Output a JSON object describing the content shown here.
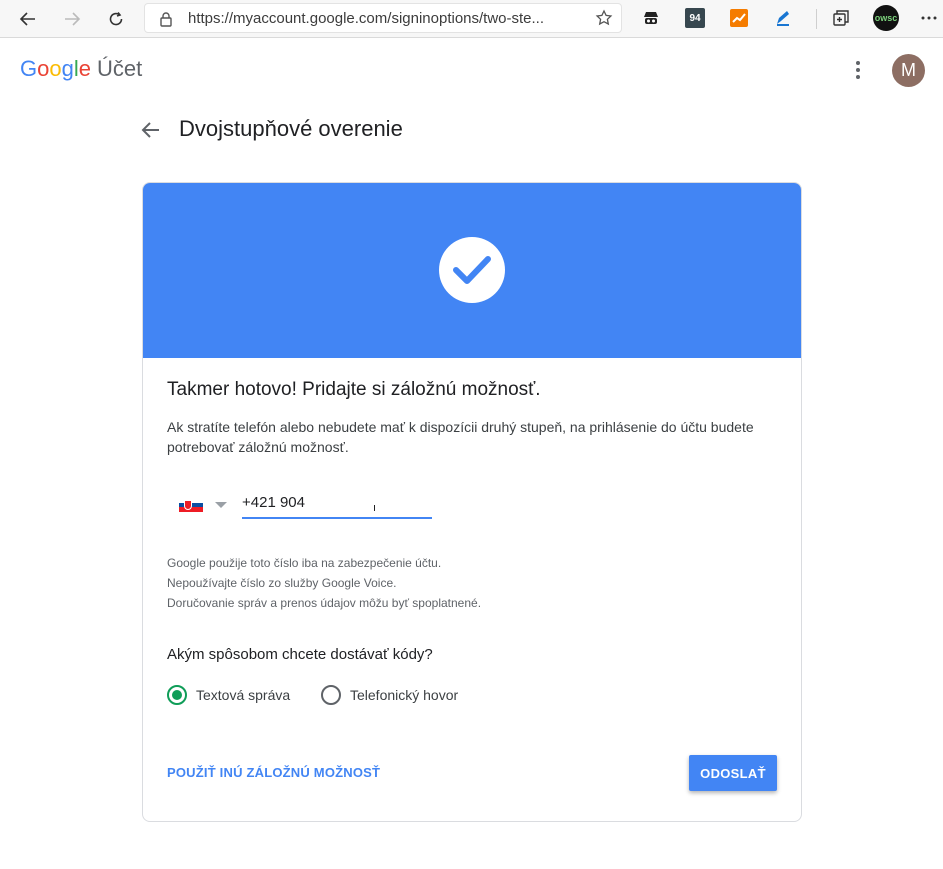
{
  "browser": {
    "url": "https://myaccount.google.com/signinoptions/two-ste...",
    "extensions": [
      "privacy-extension-icon",
      "badge-94-icon",
      "analytics-extension-icon",
      "pen-extension-icon",
      "collections-icon",
      "profile-extension-icon",
      "more-icon"
    ],
    "ext_badge": "94",
    "ext_profile": "owsc"
  },
  "header": {
    "logo_google": "Google",
    "logo_account": "Účet",
    "avatar_initial": "M"
  },
  "page": {
    "title": "Dvojstupňové overenie"
  },
  "card": {
    "hero_color": "#4285f4",
    "heading": "Takmer hotovo! Pridajte si záložnú možnosť.",
    "description": "Ak stratíte telefón alebo nebudete mať k dispozícii druhý stupeň, na prihlásenie do účtu budete potrebovať záložnú možnosť.",
    "country_flag": "Slovakia",
    "phone_value": "+421 904",
    "notes": [
      "Google použije toto číslo iba na zabezpečenie účtu.",
      "Nepoužívajte číslo zo služby Google Voice.",
      "Doručovanie správ a prenos údajov môžu byť spoplatnené."
    ],
    "question": "Akým spôsobom chcete dostávať kódy?",
    "options": [
      {
        "label": "Textová správa",
        "selected": true
      },
      {
        "label": "Telefonický hovor",
        "selected": false
      }
    ],
    "alt_option_label": "POUŽIŤ INÚ ZÁLOŽNÚ MOŽNOSŤ",
    "send_label": "ODOSLAŤ"
  }
}
